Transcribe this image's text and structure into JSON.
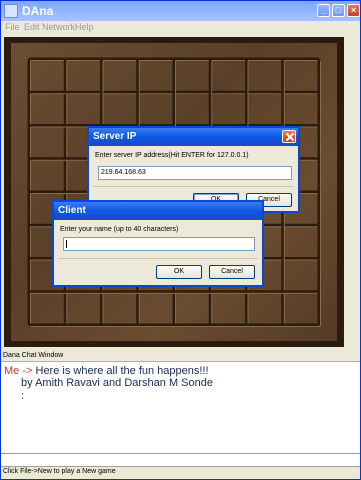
{
  "window": {
    "title": "DAna"
  },
  "menu": [
    "File",
    "Edit",
    "Network",
    "Help"
  ],
  "server_dialog": {
    "title": "Server IP",
    "prompt": "Enter server IP address(Hit ENTER for 127.0.0.1)",
    "value": "219.64.168.63",
    "ok": "OK",
    "cancel": "Cancel"
  },
  "client_dialog": {
    "title": "Client",
    "prompt": "Enter your name (up to 40 characters)",
    "value": "",
    "ok": "OK",
    "cancel": "Cancel"
  },
  "chat": {
    "label": "Dana Chat Window",
    "sender": "Me ->",
    "message": " Here is where all the fun happens!!!",
    "line2": "by Amith Ravavi and Darshan M Sonde",
    "line3": ":"
  },
  "status": "Click File->New to play a New game",
  "colors": {
    "title_blue": "#0f58e3",
    "board_wood": "#5a4029",
    "sender_red": "#c0392b"
  }
}
